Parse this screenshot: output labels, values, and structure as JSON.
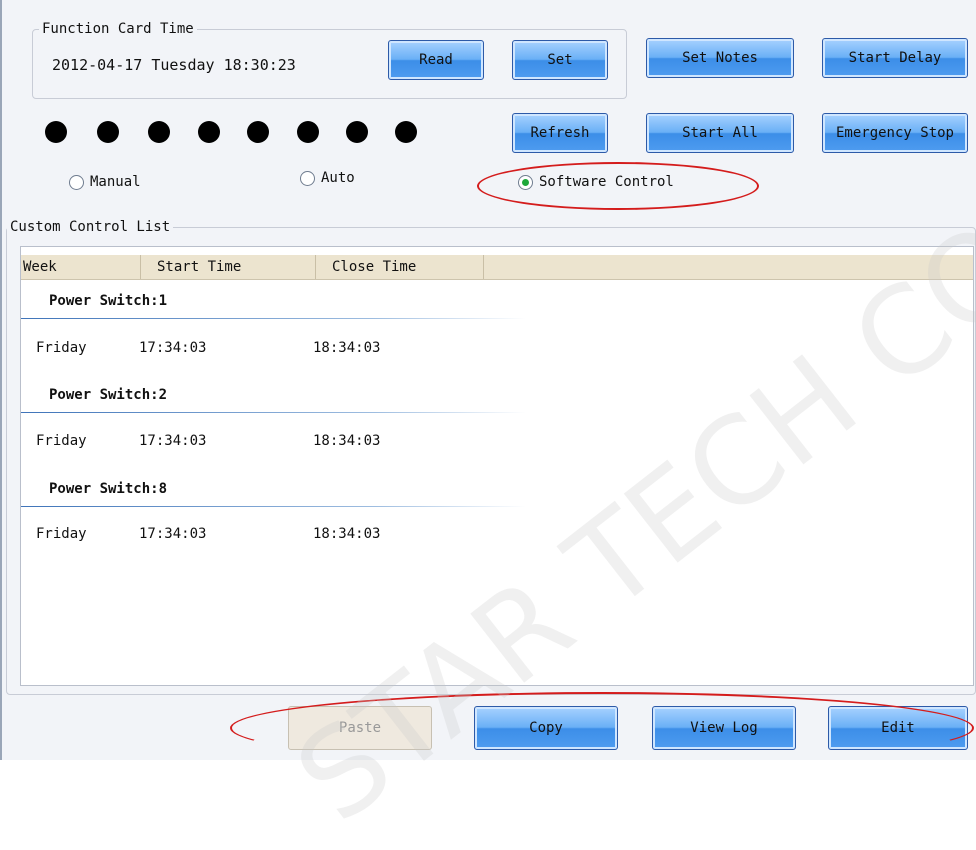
{
  "card_time": {
    "legend": "Function Card Time",
    "value": "2012-04-17 Tuesday 18:30:23",
    "read_label": "Read",
    "set_label": "Set"
  },
  "top_buttons": {
    "set_notes": "Set Notes",
    "start_delay": "Start Delay",
    "refresh": "Refresh",
    "start_all": "Start All",
    "emergency_stop": "Emergency Stop"
  },
  "status_lights_count": 8,
  "modes": {
    "manual": "Manual",
    "auto": "Auto",
    "software_control": "Software Control",
    "selected": "software_control"
  },
  "custom_list": {
    "legend": "Custom Control List",
    "columns": [
      "Week",
      "Start Time",
      "Close Time"
    ],
    "groups": [
      {
        "title": "Power Switch:1",
        "rows": [
          {
            "week": "Friday",
            "start": "17:34:03",
            "close": "18:34:03"
          }
        ]
      },
      {
        "title": "Power Switch:2",
        "rows": [
          {
            "week": "Friday",
            "start": "17:34:03",
            "close": "18:34:03"
          }
        ]
      },
      {
        "title": "Power Switch:8",
        "rows": [
          {
            "week": "Friday",
            "start": "17:34:03",
            "close": "18:34:03"
          }
        ]
      }
    ]
  },
  "bottom_buttons": {
    "paste": "Paste",
    "copy": "Copy",
    "view_log": "View Log",
    "edit": "Edit"
  },
  "watermark": "STAR TECH CO., LTD",
  "colors": {
    "button_blue": "#4f9cf0",
    "highlight_red": "#d41c1c",
    "radio_selected": "#1ea83a"
  }
}
